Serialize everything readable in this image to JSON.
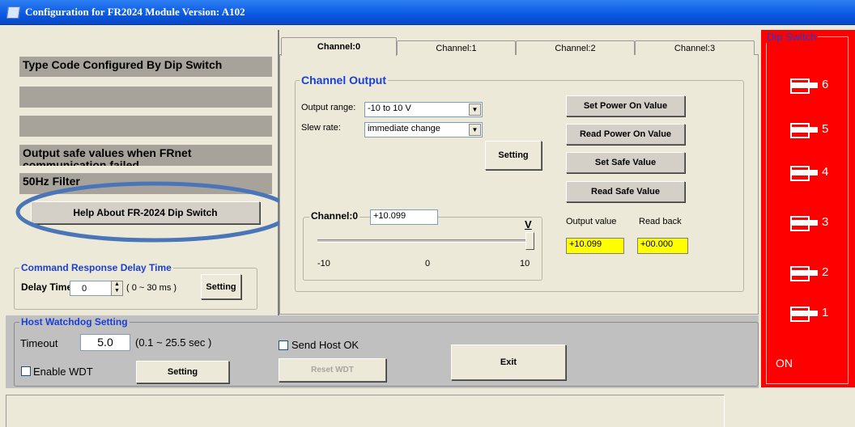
{
  "window": {
    "title": "Configuration for FR2024 Module Version: A102"
  },
  "left": {
    "type_code_label": "Type Code Configured By Dip Switch",
    "safe_values_label": "Output safe values when FRnet communication failed",
    "filter_label": "50Hz Filter",
    "help_button": "Help About  FR-2024 Dip Switch"
  },
  "cmd_delay": {
    "group_label": "Command Response Delay Time",
    "delay_label": "Delay Time",
    "delay_value": "0",
    "range_hint": "( 0 ~ 30 ms )",
    "setting_button": "Setting"
  },
  "tabs": [
    {
      "label": "Channel:0",
      "active": true
    },
    {
      "label": "Channel:1",
      "active": false
    },
    {
      "label": "Channel:2",
      "active": false
    },
    {
      "label": "Channel:3",
      "active": false
    }
  ],
  "channel_output": {
    "group_label": "Channel Output",
    "output_range_label": "Output range:",
    "output_range_value": "-10 to 10 V",
    "slew_rate_label": "Slew rate:",
    "slew_rate_value": "immediate change",
    "setting_button": "Setting",
    "set_power_on": "Set Power On Value",
    "read_power_on": "Read Power On Value",
    "set_safe": "Set Safe Value",
    "read_safe": "Read Safe Value",
    "channel_label": "Channel:0",
    "channel_value": "+10.099",
    "unit": "V",
    "slider_min": "-10",
    "slider_mid": "0",
    "slider_max": "10",
    "slider_fraction": 1.0,
    "output_value_label": "Output value",
    "read_back_label": "Read back",
    "output_value": "+10.099",
    "read_back": "+00.000"
  },
  "watchdog": {
    "group_label": "Host Watchdog Setting",
    "timeout_label": "Timeout",
    "timeout_value": "5.0",
    "timeout_hint": "(0.1 ~ 25.5 sec )",
    "enable_wdt": "Enable WDT",
    "setting_button": "Setting",
    "send_host_ok": "Send Host OK",
    "reset_wdt": "Reset WDT",
    "exit_button": "Exit"
  },
  "dip_switch": {
    "label": "Dip Switch",
    "switches": [
      "6",
      "5",
      "4",
      "3",
      "2",
      "1"
    ],
    "on_label": "ON"
  },
  "colors": {
    "accent": "#1a3fd6",
    "dip_bg": "#ff0000",
    "highlight": "#ffff00",
    "annotation": "#4a76b8"
  }
}
